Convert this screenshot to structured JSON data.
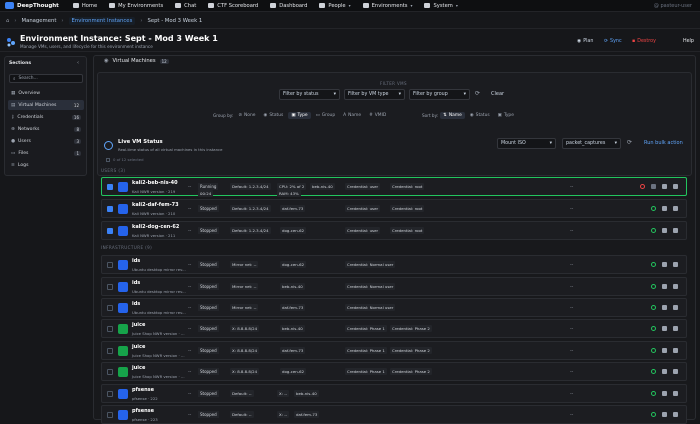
{
  "nav": {
    "brand": "DeepThought",
    "items": [
      "Home",
      "My Environments",
      "Chat",
      "CTF Scoreboard",
      "Dashboard",
      "People",
      "Environments",
      "System"
    ],
    "user": "@ pasteur-user"
  },
  "crumbs": {
    "c1": "Management",
    "c2": "Environment Instances",
    "c3": "Sept - Mod 3 Week 1"
  },
  "header": {
    "title": "Environment Instance: Sept - Mod 3 Week 1",
    "subtitle": "Manage VMs, users, and lifecycle for this environment instance",
    "plan": "Plan",
    "sync": "Sync",
    "destroy": "Destroy",
    "help": "Help"
  },
  "sidebar": {
    "title": "Sections",
    "search": "Search...",
    "items": [
      {
        "label": "Overview",
        "count": ""
      },
      {
        "label": "Virtual Machines",
        "count": "12"
      },
      {
        "label": "Credentials",
        "count": "16"
      },
      {
        "label": "Networks",
        "count": "8"
      },
      {
        "label": "Users",
        "count": "3"
      },
      {
        "label": "Files",
        "count": "1"
      },
      {
        "label": "Logs",
        "count": ""
      }
    ]
  },
  "vm": {
    "title": "Virtual Machines",
    "count": "12"
  },
  "filters": {
    "heading": "FILTER VMS",
    "status": "Filter by status",
    "vmtype": "Filter by VM type",
    "group": "Filter by group",
    "clear": "Clear",
    "groupby_label": "Group by:",
    "groupby": [
      "None",
      "Status",
      "Type",
      "Group",
      "Name",
      "VMID"
    ],
    "sortby_label": "Sort by:",
    "sortby": [
      "Name",
      "Status",
      "Type"
    ]
  },
  "live": {
    "title": "Live VM Status",
    "sub": "Real-time status of all virtual machines in this instance",
    "selected": "0 of 12 selected",
    "mount": "Mount ISO",
    "iso": "packet_captures",
    "bulk": "Run bulk action"
  },
  "groups": {
    "users": "USERS (3)",
    "infra": "INFRASTRUCTURE (9)"
  },
  "rows": [
    {
      "name": "kali2-beb-nis-40",
      "sub": "Kali NWR version · 219",
      "status": "Running",
      "net": "Default: 1.2.3.4/24",
      "extra": "CPU: 2% of 2",
      "ram": "RAM: 43%",
      "host": "beb-nis-40",
      "c1": "Credential: user",
      "c2": "Credential: root",
      "dash": "--",
      "timer": "00:24"
    },
    {
      "name": "kali2-daf-fem-73",
      "sub": "Kali NWR version · 210",
      "status": "Stopped",
      "net": "Default: 1.2.3.4/24",
      "host": "daf-fem-73",
      "c1": "Credential: user",
      "c2": "Credential: root",
      "dash": "--"
    },
    {
      "name": "kali2-dog-cen-62",
      "sub": "Kali NWR version · 211",
      "status": "Stopped",
      "net": "Default: 1.2.3.4/24",
      "host": "dog-cen-62",
      "c1": "Credential: user",
      "c2": "Credential: root",
      "dash": "--"
    },
    {
      "name": "ids",
      "sub": "Ubuntu desktop mirror rev...",
      "status": "Stopped",
      "net": "Mirror net: --",
      "host": "dog-cen-62",
      "c1": "Credential: Normal user",
      "c2": "",
      "dash": "--"
    },
    {
      "name": "ids",
      "sub": "Ubuntu desktop mirror rev...",
      "status": "Stopped",
      "net": "Mirror net: --",
      "host": "beb-nis-40",
      "c1": "Credential: Normal user",
      "c2": "",
      "dash": "--"
    },
    {
      "name": "ids",
      "sub": "Ubuntu desktop mirror rev...",
      "status": "Stopped",
      "net": "Mirror net: --",
      "host": "daf-fem-73",
      "c1": "Credential: Normal user",
      "c2": "",
      "dash": "--"
    },
    {
      "name": "juice",
      "sub": "Juice Shop NWR version · ...",
      "status": "Stopped",
      "net": "X: 8.8.8.8/24",
      "host": "beb-nis-40",
      "c1": "Credential: Phase 1",
      "c2": "Credential: Phase 2",
      "dash": "--"
    },
    {
      "name": "juice",
      "sub": "Juice Shop NWR version · ...",
      "status": "Stopped",
      "net": "X: 8.8.8.8/24",
      "host": "daf-fem-73",
      "c1": "Credential: Phase 1",
      "c2": "Credential: Phase 2",
      "dash": "--"
    },
    {
      "name": "juice",
      "sub": "Juice Shop NWR version · ...",
      "status": "Stopped",
      "net": "X: 8.8.8.8/24",
      "host": "dog-cen-62",
      "c1": "Credential: Phase 1",
      "c2": "Credential: Phase 2",
      "dash": "--"
    },
    {
      "name": "pfsense",
      "sub": "pfsense · 222",
      "status": "Stopped",
      "net": "Default: --",
      "extra": "X: --",
      "host": "beb-nis-40",
      "c1": "",
      "c2": "",
      "dash": "--"
    },
    {
      "name": "pfsense",
      "sub": "pfsense · 223",
      "status": "Stopped",
      "net": "Default: --",
      "extra": "X: --",
      "host": "daf-fem-73",
      "c1": "",
      "c2": "",
      "dash": "--"
    }
  ]
}
